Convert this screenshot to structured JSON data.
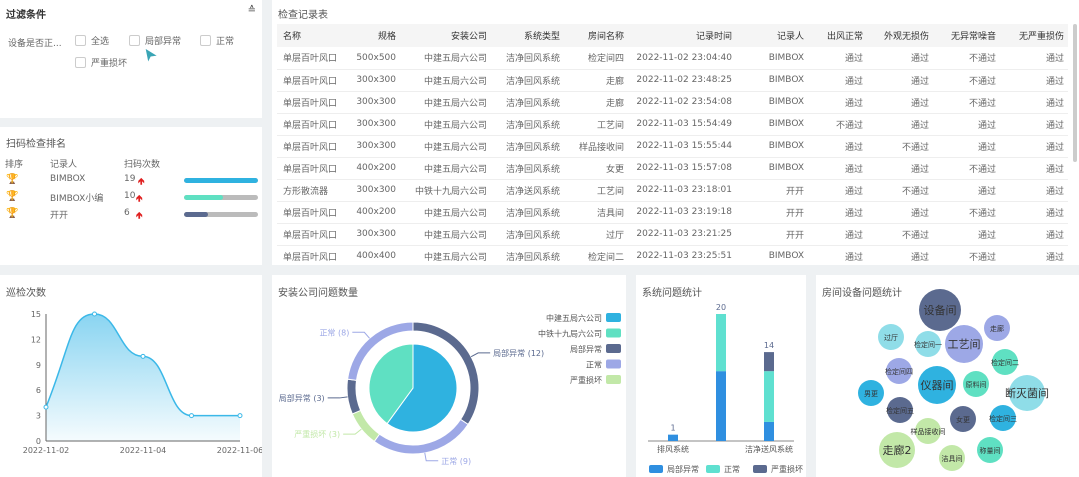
{
  "filter": {
    "title": "过滤条件",
    "collapse_icon": "double-chevron-up",
    "label": "设备是否正...",
    "options": [
      "全选",
      "局部异常",
      "正常",
      "严重损坏"
    ]
  },
  "ranking": {
    "title": "扫码检查排名",
    "headers": [
      "排序",
      "记录人",
      "扫码次数"
    ],
    "rows": [
      {
        "medal": "gold",
        "name": "BIMBOX",
        "count": "19",
        "fraction": 1.0,
        "color": "#2fb2e0"
      },
      {
        "medal": "silver",
        "name": "BIMBOX小编",
        "count": "10",
        "fraction": 0.53,
        "color": "#5fe0c2"
      },
      {
        "medal": "bronze",
        "name": "开开",
        "count": "6",
        "fraction": 0.32,
        "color": "#5b6a8f"
      }
    ],
    "trend_icon": "arrow-up",
    "medal_colors": {
      "gold": "#f5c518",
      "silver": "#d0d0d0",
      "bronze": "#d9a37a"
    }
  },
  "table": {
    "title": "检查记录表",
    "headers": [
      "名称",
      "规格",
      "安装公司",
      "系统类型",
      "房间名称",
      "记录时间",
      "记录人",
      "出风正常",
      "外观无损伤",
      "无异常噪音",
      "无严重损伤"
    ],
    "rows": [
      [
        "单层百叶风口",
        "500x500",
        "中建五局六公司",
        "洁净回风系统",
        "检定间四",
        "2022-11-02 23:04:40",
        "BIMBOX",
        "通过",
        "通过",
        "不通过",
        "通过"
      ],
      [
        "单层百叶风口",
        "300x300",
        "中建五局六公司",
        "洁净回风系统",
        "走廊",
        "2022-11-02 23:48:25",
        "BIMBOX",
        "通过",
        "通过",
        "不通过",
        "通过"
      ],
      [
        "单层百叶风口",
        "300x300",
        "中建五局六公司",
        "洁净回风系统",
        "走廊",
        "2022-11-02 23:54:08",
        "BIMBOX",
        "通过",
        "通过",
        "不通过",
        "通过"
      ],
      [
        "单层百叶风口",
        "300x300",
        "中建五局六公司",
        "洁净回风系统",
        "工艺间",
        "2022-11-03 15:54:49",
        "BIMBOX",
        "不通过",
        "通过",
        "通过",
        "通过"
      ],
      [
        "单层百叶风口",
        "300x300",
        "中建五局六公司",
        "洁净回风系统",
        "样品接收间",
        "2022-11-03 15:55:44",
        "BIMBOX",
        "通过",
        "不通过",
        "通过",
        "通过"
      ],
      [
        "单层百叶风口",
        "400x200",
        "中建五局六公司",
        "洁净回风系统",
        "女更",
        "2022-11-03 15:57:08",
        "BIMBOX",
        "通过",
        "通过",
        "不通过",
        "通过"
      ],
      [
        "方形散流器",
        "300x300",
        "中铁十九局六公司",
        "洁净送风系统",
        "工艺间",
        "2022-11-03 23:18:01",
        "开开",
        "通过",
        "不通过",
        "通过",
        "通过"
      ],
      [
        "单层百叶风口",
        "400x200",
        "中建五局六公司",
        "洁净回风系统",
        "洁具间",
        "2022-11-03 23:19:18",
        "开开",
        "通过",
        "通过",
        "不通过",
        "通过"
      ],
      [
        "单层百叶风口",
        "300x300",
        "中建五局六公司",
        "洁净回风系统",
        "过厅",
        "2022-11-03 23:21:25",
        "开开",
        "通过",
        "不通过",
        "通过",
        "通过"
      ],
      [
        "单层百叶风口",
        "400x400",
        "中建五局六公司",
        "洁净回风系统",
        "检定间二",
        "2022-11-03 23:25:51",
        "BIMBOX",
        "通过",
        "通过",
        "不通过",
        "通过"
      ]
    ]
  },
  "chart_data": [
    {
      "type": "area",
      "title": "巡检次数",
      "x": [
        "2022-11-02",
        "2022-11-03",
        "2022-11-04",
        "2022-11-05",
        "2022-11-06"
      ],
      "values": [
        4,
        15,
        10,
        3,
        3
      ],
      "xticks": [
        "2022-11-02",
        "2022-11-04",
        "2022-11-06"
      ],
      "yticks": [
        "0",
        "3",
        "6",
        "9",
        "12",
        "15"
      ],
      "ylim": [
        0,
        15
      ],
      "color": "#3bb8e8"
    },
    {
      "type": "pie",
      "title": "安装公司问题数量",
      "inner": [
        {
          "name": "中建五局六公司",
          "value": 21,
          "color": "#2fb2e0"
        },
        {
          "name": "中铁十九局六公司",
          "value": 14,
          "color": "#5fe0c2"
        }
      ],
      "outer": [
        {
          "name": "局部异常",
          "value": 12,
          "label": "局部异常 (12)",
          "color": "#5b6a8f"
        },
        {
          "name": "正常",
          "value": 9,
          "label": "正常 (9)",
          "color": "#9da8e6"
        },
        {
          "name": "严重损坏",
          "value": 3,
          "label": "严重损坏 (3)",
          "color": "#c2e8a8"
        },
        {
          "name": "局部异常",
          "value": 3,
          "label": "局部异常 (3)",
          "color": "#5b6a8f"
        },
        {
          "name": "正常",
          "value": 8,
          "label": "正常 (8)",
          "color": "#9da8e6"
        }
      ],
      "legend": [
        {
          "name": "中建五局六公司",
          "color": "#2fb2e0"
        },
        {
          "name": "中铁十九局六公司",
          "color": "#5fe0c2"
        },
        {
          "name": "局部异常",
          "color": "#5b6a8f"
        },
        {
          "name": "正常",
          "color": "#9da8e6"
        },
        {
          "name": "严重损坏",
          "color": "#c2e8a8"
        }
      ],
      "legend_position": "right"
    },
    {
      "type": "bar",
      "stacked": true,
      "title": "系统问题统计",
      "categories": [
        "排风系统",
        "",
        "洁净送风系统"
      ],
      "series": [
        {
          "name": "局部异常",
          "values": [
            1,
            11,
            3
          ],
          "color": "#2f8fe0"
        },
        {
          "name": "正常",
          "values": [
            0,
            9,
            8
          ],
          "color": "#5fe0d0"
        },
        {
          "name": "严重损坏",
          "values": [
            0,
            0,
            3
          ],
          "color": "#5b6a8f"
        }
      ],
      "totals": [
        "1",
        "20",
        "14"
      ],
      "legend_position": "bottom"
    },
    {
      "type": "bubble",
      "title": "房间设备问题统计",
      "items": [
        {
          "name": "设备间",
          "color": "#5b6a8f"
        },
        {
          "name": "过厅",
          "color": "#8fdde8"
        },
        {
          "name": "检定间一",
          "color": "#8fdde8"
        },
        {
          "name": "工艺间",
          "color": "#9da8e6"
        },
        {
          "name": "走廊",
          "color": "#9da8e6"
        },
        {
          "name": "检定间二",
          "color": "#5fe0c2"
        },
        {
          "name": "检定间四",
          "color": "#9da8e6"
        },
        {
          "name": "仪器间",
          "color": "#2fb2e0"
        },
        {
          "name": "原料间",
          "color": "#5fe0c2"
        },
        {
          "name": "断灭菌间",
          "color": "#8fdde8"
        },
        {
          "name": "男更",
          "color": "#2fb2e0"
        },
        {
          "name": "检定间五",
          "color": "#5b6a8f"
        },
        {
          "name": "女更",
          "color": "#5b6a8f"
        },
        {
          "name": "检定间三",
          "color": "#2fb2e0"
        },
        {
          "name": "样品接收间",
          "color": "#c2e8a8"
        },
        {
          "name": "走廊2",
          "color": "#c2e8a8"
        },
        {
          "name": "洁具间",
          "color": "#c2e8a8"
        },
        {
          "name": "称量间",
          "color": "#5fe0c2"
        }
      ]
    }
  ]
}
